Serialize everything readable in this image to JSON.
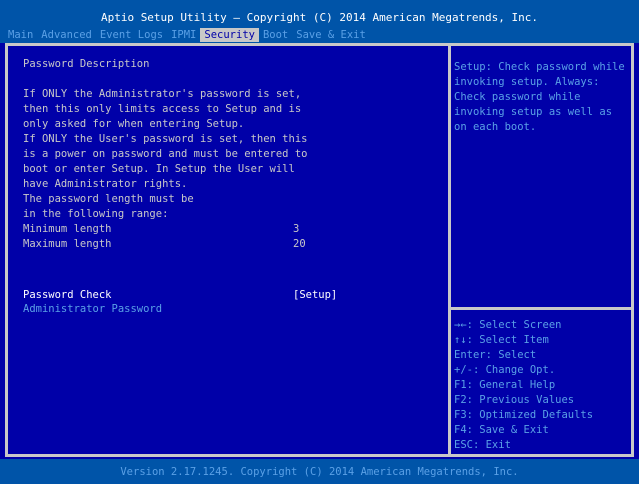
{
  "title": "Aptio Setup Utility – Copyright (C) 2014 American Megatrends, Inc.",
  "menu": [
    {
      "label": "Main",
      "active": false
    },
    {
      "label": "Advanced",
      "active": false
    },
    {
      "label": "Event Logs",
      "active": false
    },
    {
      "label": "IPMI",
      "active": false
    },
    {
      "label": "Security",
      "active": true
    },
    {
      "label": "Boot",
      "active": false
    },
    {
      "label": "Save & Exit",
      "active": false
    }
  ],
  "main": {
    "heading": "Password Description",
    "description": [
      "If ONLY the Administrator's password is set,",
      "then this only limits access to Setup and is",
      "only asked for when entering Setup.",
      "If ONLY the User's password is set, then this",
      "is a power on password and must be entered to",
      "boot or enter Setup. In Setup the User will",
      "have Administrator rights.",
      "The password length must be",
      "in the following range:"
    ],
    "min_label": "Minimum length",
    "min_value": "3",
    "max_label": "Maximum length",
    "max_value": "20",
    "password_check_label": "Password Check",
    "password_check_value": "[Setup]",
    "admin_password_label": "Administrator Password"
  },
  "help": [
    "Setup: Check password while",
    "invoking setup. Always:",
    "Check password while",
    "invoking setup as well as",
    "on each boot."
  ],
  "keys": [
    "→←: Select Screen",
    "↑↓: Select Item",
    "Enter: Select",
    "+/-: Change Opt.",
    "F1: General Help",
    "F2: Previous Values",
    "F3: Optimized Defaults",
    "F4: Save & Exit",
    "ESC: Exit"
  ],
  "footer": "Version 2.17.1245. Copyright (C) 2014 American Megatrends, Inc.",
  "colors": {
    "background": "#0000a8",
    "header": "#0054a8",
    "frame": "#c8c8c8",
    "highlight_text": "#5aa0e6",
    "title_text": "#ffffff"
  }
}
